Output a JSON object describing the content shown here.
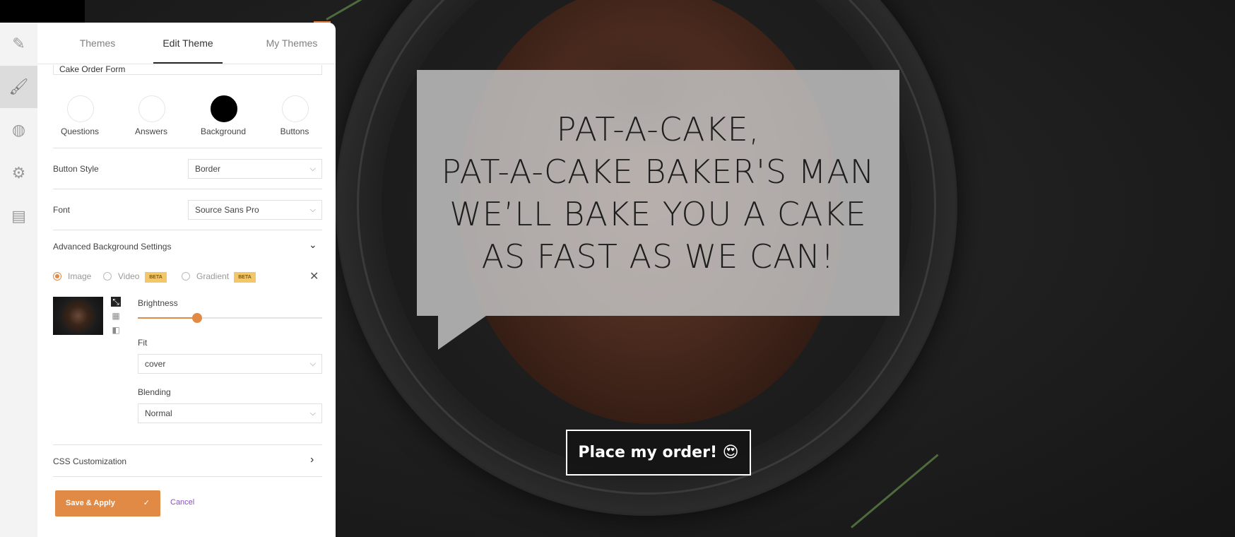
{
  "tabs": [
    "Themes",
    "Edit Theme",
    "My Themes"
  ],
  "form_name": "Cake Order Form",
  "colors": {
    "swatches": [
      {
        "label": "Questions",
        "color": "#ffffff"
      },
      {
        "label": "Answers",
        "color": "#ffffff"
      },
      {
        "label": "Background",
        "color": "#000000"
      },
      {
        "label": "Buttons",
        "color": "#ffffff"
      }
    ],
    "accent": "#e08a46"
  },
  "button_style": {
    "label": "Button Style",
    "value": "Border"
  },
  "font": {
    "label": "Font",
    "value": "Source Sans Pro"
  },
  "advanced_bg": {
    "title": "Advanced Background Settings",
    "options": {
      "image": "Image",
      "video": "Video",
      "gradient": "Gradient",
      "beta": "BETA"
    },
    "selected": "Image",
    "brightness": {
      "label": "Brightness",
      "value_fraction": 0.32
    },
    "fit": {
      "label": "Fit",
      "value": "cover"
    },
    "blending": {
      "label": "Blending",
      "value": "Normal"
    }
  },
  "css_customization": "CSS Customization",
  "actions": {
    "save": "Save & Apply",
    "cancel": "Cancel"
  },
  "preview": {
    "lines": [
      "PAT-A-CAKE,",
      "PAT-A-CAKE BAKER'S MAN",
      "WE’LL BAKE YOU A CAKE",
      "AS FAST AS WE CAN!"
    ],
    "button": "Place my order! 😍"
  },
  "rail_icons": [
    "pencil-icon",
    "brush-icon",
    "globe-icon",
    "gear-icon",
    "printer-icon"
  ]
}
